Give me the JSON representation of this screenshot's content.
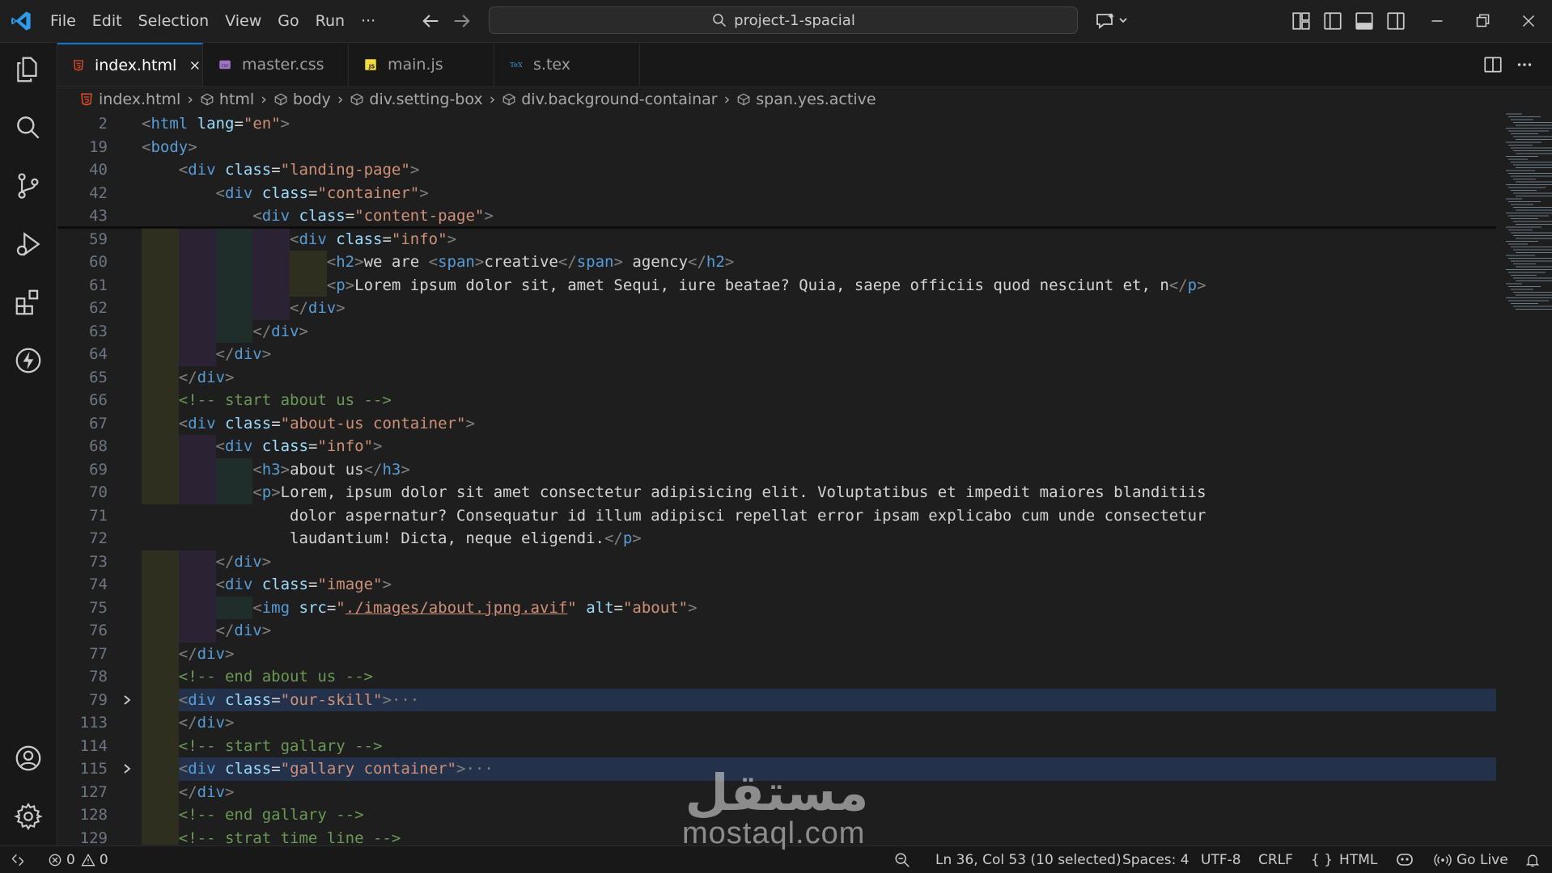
{
  "titlebar": {
    "menu": [
      "File",
      "Edit",
      "Selection",
      "View",
      "Go",
      "Run",
      "···"
    ],
    "search_text": "project-1-spacial"
  },
  "tabs": [
    {
      "label": "index.html",
      "icon": "html-file-icon",
      "active": true
    },
    {
      "label": "master.css",
      "icon": "css-file-icon",
      "active": false
    },
    {
      "label": "main.js",
      "icon": "js-file-icon",
      "active": false
    },
    {
      "label": "s.tex",
      "icon": "tex-file-icon",
      "active": false
    }
  ],
  "breadcrumb": [
    "index.html",
    "html",
    "body",
    "div.setting-box",
    "div.background-containar",
    "span.yes.active"
  ],
  "editor": {
    "lines": [
      {
        "num": "2",
        "tokens": [
          [
            "t",
            "<"
          ],
          [
            "tn",
            "html"
          ],
          [
            "tx",
            " "
          ],
          [
            "at",
            "lang"
          ],
          [
            "tx",
            "="
          ],
          [
            "av",
            "\"en\""
          ],
          [
            "t",
            ">"
          ]
        ]
      },
      {
        "num": "19",
        "tokens": [
          [
            "t",
            "<"
          ],
          [
            "tn",
            "body"
          ],
          [
            "t",
            ">"
          ]
        ]
      },
      {
        "num": "40",
        "tokens": [
          [
            "tx",
            "    "
          ],
          [
            "t",
            "<"
          ],
          [
            "tn",
            "div"
          ],
          [
            "tx",
            " "
          ],
          [
            "at",
            "class"
          ],
          [
            "tx",
            "="
          ],
          [
            "av",
            "\"landing-page\""
          ],
          [
            "t",
            ">"
          ]
        ]
      },
      {
        "num": "42",
        "tokens": [
          [
            "tx",
            "        "
          ],
          [
            "t",
            "<"
          ],
          [
            "tn",
            "div"
          ],
          [
            "tx",
            " "
          ],
          [
            "at",
            "class"
          ],
          [
            "tx",
            "="
          ],
          [
            "av",
            "\"container\""
          ],
          [
            "t",
            ">"
          ]
        ]
      },
      {
        "num": "43",
        "tokens": [
          [
            "tx",
            "            "
          ],
          [
            "t",
            "<"
          ],
          [
            "tn",
            "div"
          ],
          [
            "tx",
            " "
          ],
          [
            "at",
            "class"
          ],
          [
            "tx",
            "="
          ],
          [
            "av",
            "\"content-page\""
          ],
          [
            "t",
            ">"
          ]
        ]
      },
      {
        "num": "59",
        "tokens": [
          [
            "tx",
            "                "
          ],
          [
            "t",
            "<"
          ],
          [
            "tn",
            "div"
          ],
          [
            "tx",
            " "
          ],
          [
            "at",
            "class"
          ],
          [
            "tx",
            "="
          ],
          [
            "av",
            "\"info\""
          ],
          [
            "t",
            ">"
          ]
        ]
      },
      {
        "num": "60",
        "tokens": [
          [
            "tx",
            "                    "
          ],
          [
            "t",
            "<"
          ],
          [
            "tn",
            "h2"
          ],
          [
            "t",
            ">"
          ],
          [
            "tx",
            "we are "
          ],
          [
            "t",
            "<"
          ],
          [
            "tn",
            "span"
          ],
          [
            "t",
            ">"
          ],
          [
            "tx",
            "creative"
          ],
          [
            "t",
            "</"
          ],
          [
            "tn",
            "span"
          ],
          [
            "t",
            ">"
          ],
          [
            "tx",
            " agency"
          ],
          [
            "t",
            "</"
          ],
          [
            "tn",
            "h2"
          ],
          [
            "t",
            ">"
          ]
        ]
      },
      {
        "num": "61",
        "tokens": [
          [
            "tx",
            "                    "
          ],
          [
            "t",
            "<"
          ],
          [
            "tn",
            "p"
          ],
          [
            "t",
            ">"
          ],
          [
            "tx",
            "Lorem ipsum dolor sit, amet Sequi, iure beatae? Quia, saepe officiis quod nesciunt et, n"
          ],
          [
            "t",
            "</"
          ],
          [
            "tn",
            "p"
          ],
          [
            "t",
            ">"
          ]
        ]
      },
      {
        "num": "62",
        "tokens": [
          [
            "tx",
            "                "
          ],
          [
            "t",
            "</"
          ],
          [
            "tn",
            "div"
          ],
          [
            "t",
            ">"
          ]
        ]
      },
      {
        "num": "63",
        "tokens": [
          [
            "tx",
            "            "
          ],
          [
            "t",
            "</"
          ],
          [
            "tn",
            "div"
          ],
          [
            "t",
            ">"
          ]
        ]
      },
      {
        "num": "64",
        "tokens": [
          [
            "tx",
            "        "
          ],
          [
            "t",
            "</"
          ],
          [
            "tn",
            "div"
          ],
          [
            "t",
            ">"
          ]
        ]
      },
      {
        "num": "65",
        "tokens": [
          [
            "tx",
            "    "
          ],
          [
            "t",
            "</"
          ],
          [
            "tn",
            "div"
          ],
          [
            "t",
            ">"
          ]
        ]
      },
      {
        "num": "66",
        "tokens": [
          [
            "tx",
            "    "
          ],
          [
            "cm",
            "<!-- start about us -->"
          ]
        ]
      },
      {
        "num": "67",
        "tokens": [
          [
            "tx",
            "    "
          ],
          [
            "t",
            "<"
          ],
          [
            "tn",
            "div"
          ],
          [
            "tx",
            " "
          ],
          [
            "at",
            "class"
          ],
          [
            "tx",
            "="
          ],
          [
            "av",
            "\"about-us container\""
          ],
          [
            "t",
            ">"
          ]
        ]
      },
      {
        "num": "68",
        "tokens": [
          [
            "tx",
            "        "
          ],
          [
            "t",
            "<"
          ],
          [
            "tn",
            "div"
          ],
          [
            "tx",
            " "
          ],
          [
            "at",
            "class"
          ],
          [
            "tx",
            "="
          ],
          [
            "av",
            "\"info\""
          ],
          [
            "t",
            ">"
          ]
        ]
      },
      {
        "num": "69",
        "tokens": [
          [
            "tx",
            "            "
          ],
          [
            "t",
            "<"
          ],
          [
            "tn",
            "h3"
          ],
          [
            "t",
            ">"
          ],
          [
            "tx",
            "about us"
          ],
          [
            "t",
            "</"
          ],
          [
            "tn",
            "h3"
          ],
          [
            "t",
            ">"
          ]
        ]
      },
      {
        "num": "70",
        "tokens": [
          [
            "tx",
            "            "
          ],
          [
            "t",
            "<"
          ],
          [
            "tn",
            "p"
          ],
          [
            "t",
            ">"
          ],
          [
            "tx",
            "Lorem, ipsum dolor sit amet consectetur adipisicing elit. Voluptatibus et impedit maiores blanditiis"
          ]
        ]
      },
      {
        "num": "71",
        "tokens": [
          [
            "tx",
            "                dolor aspernatur? Consequatur id illum adipisci repellat error ipsam explicabo cum unde consectetur"
          ]
        ]
      },
      {
        "num": "72",
        "tokens": [
          [
            "tx",
            "                laudantium! Dicta, neque eligendi."
          ],
          [
            "t",
            "</"
          ],
          [
            "tn",
            "p"
          ],
          [
            "t",
            ">"
          ]
        ]
      },
      {
        "num": "73",
        "tokens": [
          [
            "tx",
            "        "
          ],
          [
            "t",
            "</"
          ],
          [
            "tn",
            "div"
          ],
          [
            "t",
            ">"
          ]
        ]
      },
      {
        "num": "74",
        "tokens": [
          [
            "tx",
            "        "
          ],
          [
            "t",
            "<"
          ],
          [
            "tn",
            "div"
          ],
          [
            "tx",
            " "
          ],
          [
            "at",
            "class"
          ],
          [
            "tx",
            "="
          ],
          [
            "av",
            "\"image\""
          ],
          [
            "t",
            ">"
          ]
        ]
      },
      {
        "num": "75",
        "tokens": [
          [
            "tx",
            "            "
          ],
          [
            "t",
            "<"
          ],
          [
            "tn",
            "img"
          ],
          [
            "tx",
            " "
          ],
          [
            "at",
            "src"
          ],
          [
            "tx",
            "="
          ],
          [
            "av",
            "\""
          ],
          [
            "avu",
            "./images/about.jpng.avif"
          ],
          [
            "av",
            "\""
          ],
          [
            "tx",
            " "
          ],
          [
            "at",
            "alt"
          ],
          [
            "tx",
            "="
          ],
          [
            "av",
            "\"about\""
          ],
          [
            "t",
            ">"
          ]
        ]
      },
      {
        "num": "76",
        "tokens": [
          [
            "tx",
            "        "
          ],
          [
            "t",
            "</"
          ],
          [
            "tn",
            "div"
          ],
          [
            "t",
            ">"
          ]
        ]
      },
      {
        "num": "77",
        "tokens": [
          [
            "tx",
            "    "
          ],
          [
            "t",
            "</"
          ],
          [
            "tn",
            "div"
          ],
          [
            "t",
            ">"
          ]
        ]
      },
      {
        "num": "78",
        "tokens": [
          [
            "tx",
            "    "
          ],
          [
            "cm",
            "<!-- end about us -->"
          ]
        ]
      },
      {
        "num": "79",
        "fold": true,
        "tokens": [
          [
            "tx",
            "    "
          ],
          [
            "t",
            "<"
          ],
          [
            "tn",
            "div"
          ],
          [
            "tx",
            " "
          ],
          [
            "at",
            "class"
          ],
          [
            "tx",
            "="
          ],
          [
            "av",
            "\"our-skill\""
          ],
          [
            "t",
            ">"
          ],
          [
            "t",
            "···"
          ]
        ]
      },
      {
        "num": "113",
        "tokens": [
          [
            "tx",
            "    "
          ],
          [
            "t",
            "</"
          ],
          [
            "tn",
            "div"
          ],
          [
            "t",
            ">"
          ]
        ]
      },
      {
        "num": "114",
        "tokens": [
          [
            "tx",
            "    "
          ],
          [
            "cm",
            "<!-- start gallary -->"
          ]
        ]
      },
      {
        "num": "115",
        "fold": true,
        "tokens": [
          [
            "tx",
            "    "
          ],
          [
            "t",
            "<"
          ],
          [
            "tn",
            "div"
          ],
          [
            "tx",
            " "
          ],
          [
            "at",
            "class"
          ],
          [
            "tx",
            "="
          ],
          [
            "av",
            "\"gallary container\""
          ],
          [
            "t",
            ">"
          ],
          [
            "t",
            "···"
          ]
        ]
      },
      {
        "num": "127",
        "tokens": [
          [
            "tx",
            "    "
          ],
          [
            "t",
            "</"
          ],
          [
            "tn",
            "div"
          ],
          [
            "t",
            ">"
          ]
        ]
      },
      {
        "num": "128",
        "tokens": [
          [
            "tx",
            "    "
          ],
          [
            "cm",
            "<!-- end gallary -->"
          ]
        ]
      },
      {
        "num": "129",
        "tokens": [
          [
            "tx",
            "    "
          ],
          [
            "cm",
            "<!-- strat time line -->"
          ]
        ]
      }
    ]
  },
  "statusbar": {
    "errors": "0",
    "warnings": "0",
    "cursor": "Ln 36, Col 53 (10 selected)",
    "spaces": "Spaces: 4",
    "encoding": "UTF-8",
    "eol": "CRLF",
    "language": "HTML",
    "go_live": "Go Live"
  },
  "watermark": {
    "logo_text": "مستقل",
    "domain": "mostaql.com"
  },
  "colors": {
    "accent": "#0078d4",
    "tag": "#569cd6",
    "attribute": "#9cdcfe",
    "string": "#ce9178",
    "comment": "#6a9955",
    "html_icon": "#e44d26",
    "css_icon": "#a074c4",
    "js_icon": "#f1dd3f"
  }
}
